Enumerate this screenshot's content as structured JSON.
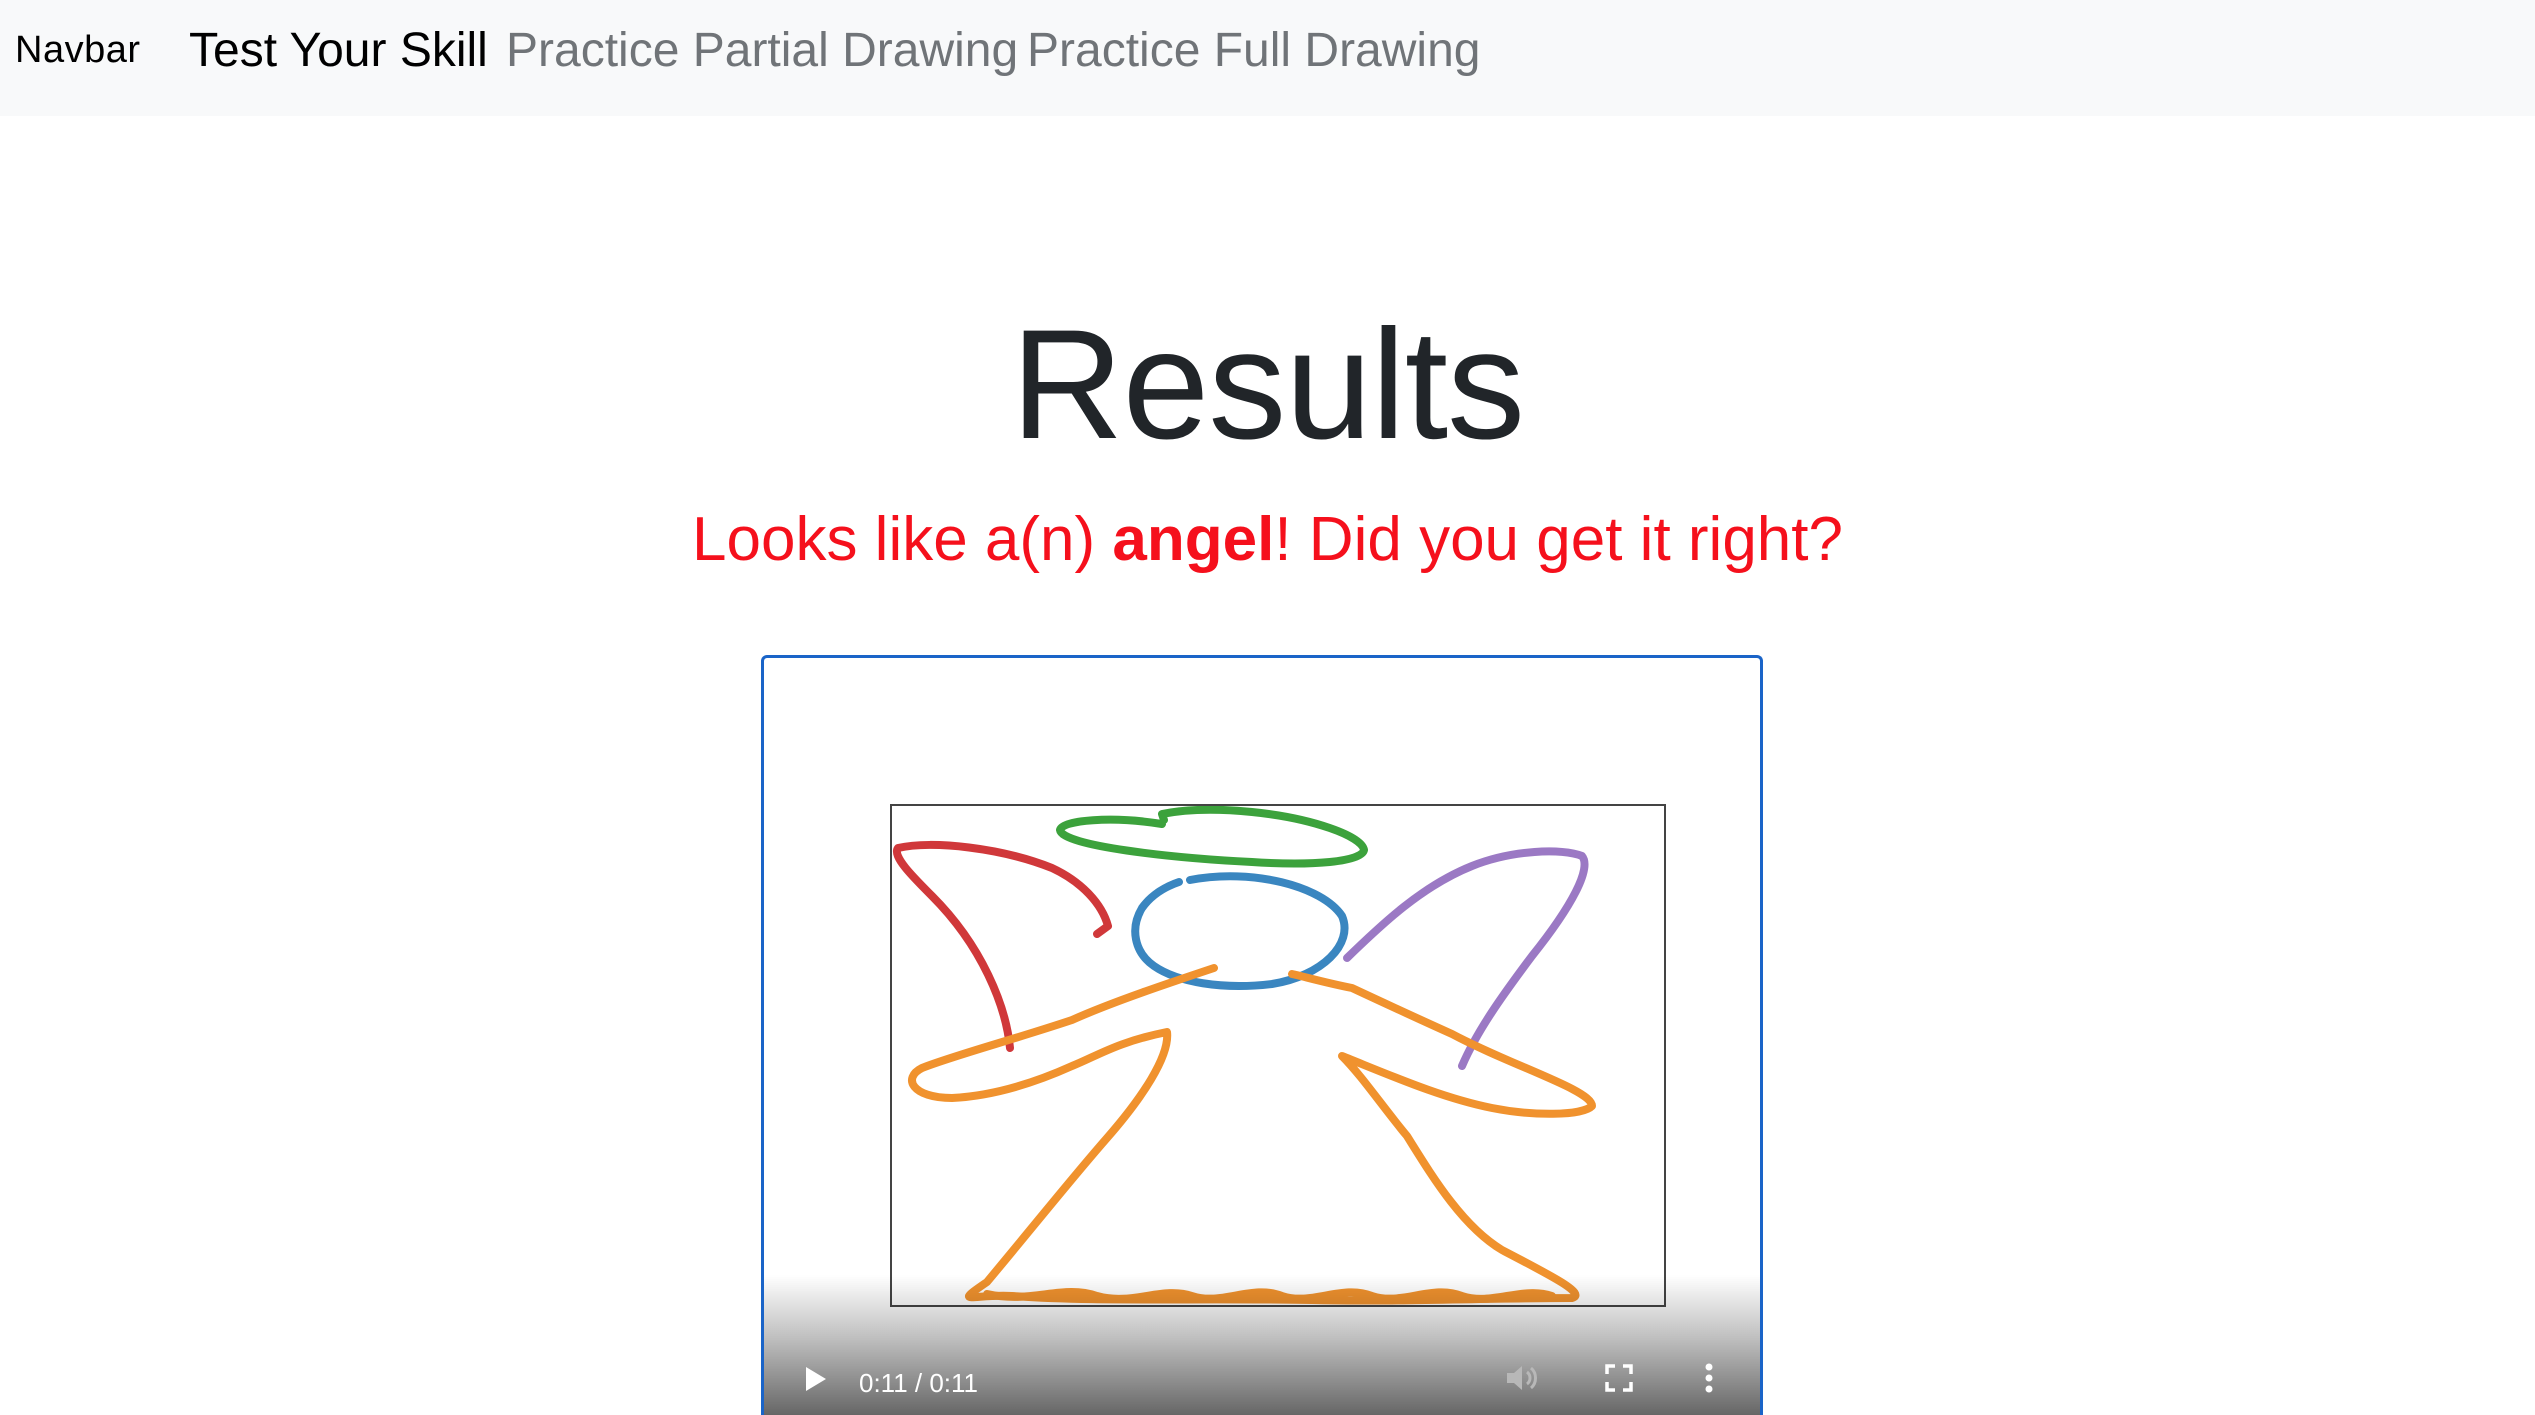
{
  "navbar": {
    "brand": "Navbar",
    "links": [
      {
        "label": "Test Your Skill",
        "active": true
      },
      {
        "label": "Practice Partial Drawing",
        "active": false
      },
      {
        "label": "Practice Full Drawing",
        "active": false
      }
    ]
  },
  "main": {
    "title": "Results",
    "result_prefix": "Looks like a(n) ",
    "guess": "angel",
    "result_suffix": "! Did you get it right?"
  },
  "video": {
    "time_display": "0:11 / 0:11",
    "progress": 1.0,
    "icons": {
      "play": "play-icon",
      "volume": "volume-icon",
      "fullscreen": "fullscreen-icon",
      "more": "more-options-icon"
    }
  },
  "colors": {
    "accent_text": "#f5101c",
    "video_border": "#1a64c8",
    "stroke_red": "#d0383a",
    "stroke_green": "#3ca23c",
    "stroke_blue": "#3a86c0",
    "stroke_purple": "#9b79c4",
    "stroke_orange": "#f0922e"
  }
}
